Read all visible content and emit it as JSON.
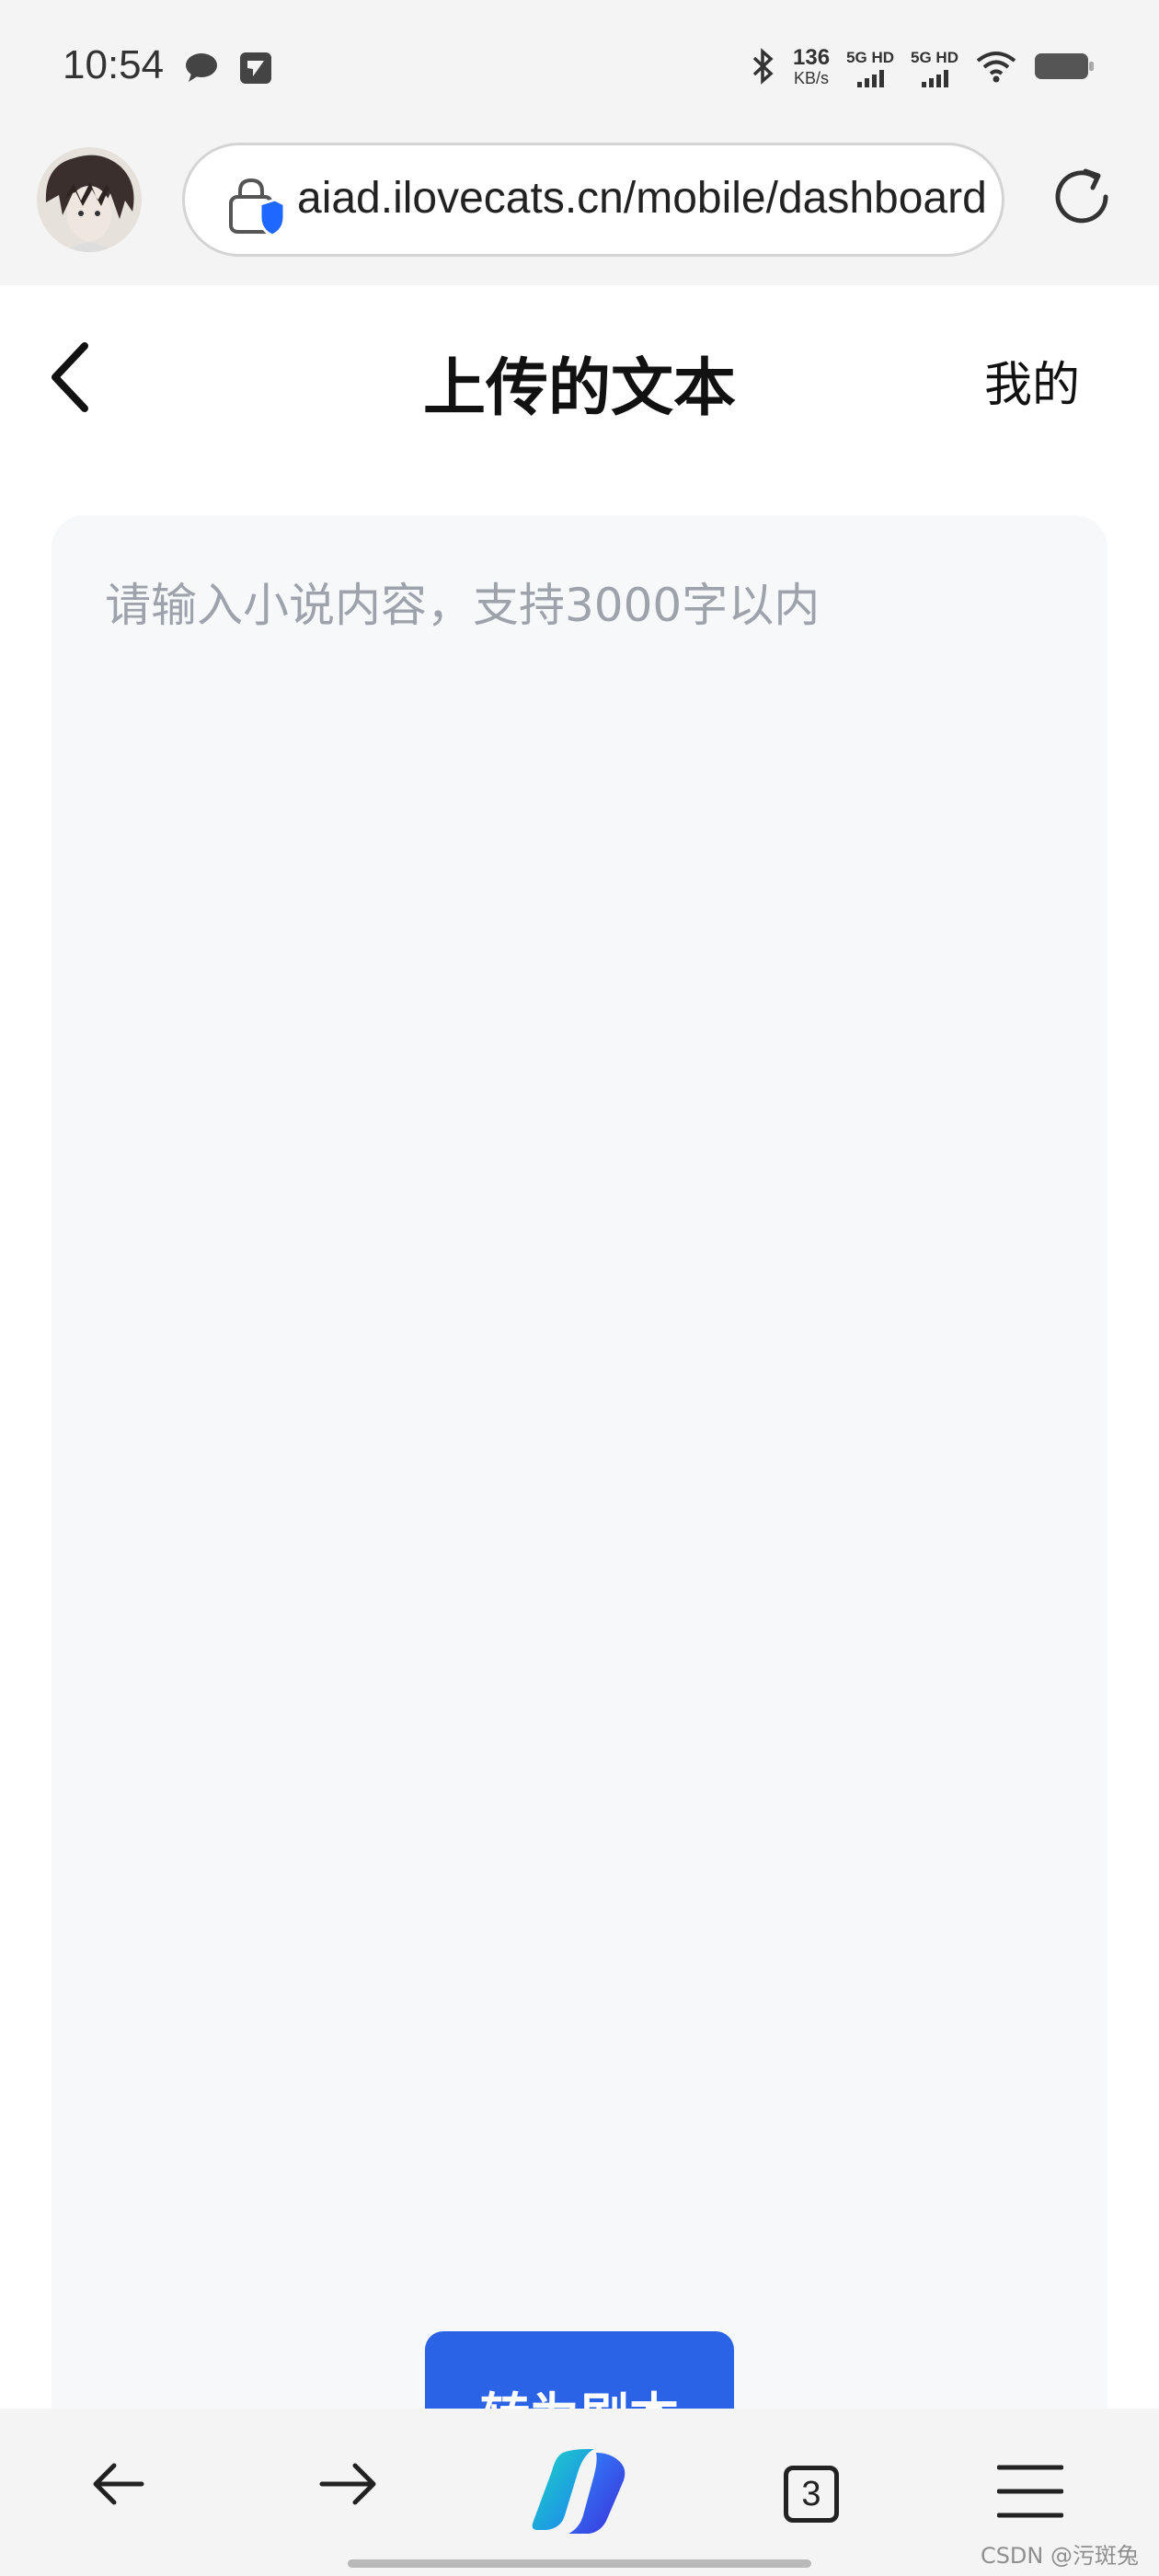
{
  "status_bar": {
    "time": "10:54",
    "speed_value": "136",
    "speed_unit": "KB/s",
    "sim1": "5G HD",
    "sim2": "5G HD",
    "icons": [
      "chat-bubble-icon",
      "app-notification-icon",
      "bluetooth-icon",
      "wifi-icon",
      "battery-icon"
    ]
  },
  "browser": {
    "url": "aiad.ilovecats.cn/mobile/dashboard",
    "accent": "#2b63e6"
  },
  "page": {
    "title": "上传的文本",
    "mine_link": "我的",
    "editor_placeholder": "请输入小说内容，支持3000字以内",
    "convert_button": "转为剧本"
  },
  "bottom_nav": {
    "tab_count": "3",
    "items": [
      "back-arrow-icon",
      "forward-arrow-icon",
      "copilot-icon",
      "tabs-icon",
      "menu-icon"
    ]
  },
  "watermark": "CSDN @污斑兔"
}
